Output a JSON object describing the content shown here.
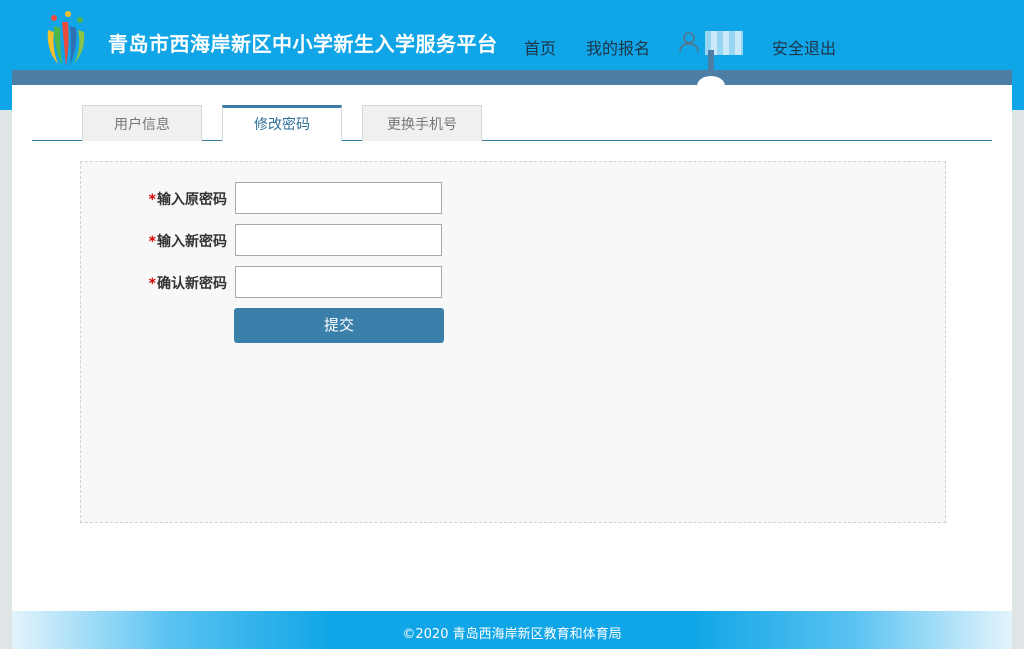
{
  "header": {
    "site_title": "青岛市西海岸新区中小学新生入学服务平台",
    "nav": {
      "home": "首页",
      "my_registration": "我的报名",
      "logout": "安全退出"
    }
  },
  "tabs": [
    {
      "label": "用户信息"
    },
    {
      "label": "修改密码",
      "active": true
    },
    {
      "label": "更换手机号"
    }
  ],
  "form": {
    "required_mark": "*",
    "fields": [
      {
        "label": "输入原密码",
        "value": ""
      },
      {
        "label": "输入新密码",
        "value": ""
      },
      {
        "label": "确认新密码",
        "value": ""
      }
    ],
    "submit_label": "提交"
  },
  "footer": {
    "text": "©2020 青岛西海岸新区教育和体育局"
  },
  "colors": {
    "header_blue": "#10a5e6",
    "stripe": "#4e7ea4",
    "accent": "#3b80ab",
    "required": "#d40000"
  },
  "icons": {
    "logo": "bamboo-flower-logo",
    "user": "user-icon"
  }
}
